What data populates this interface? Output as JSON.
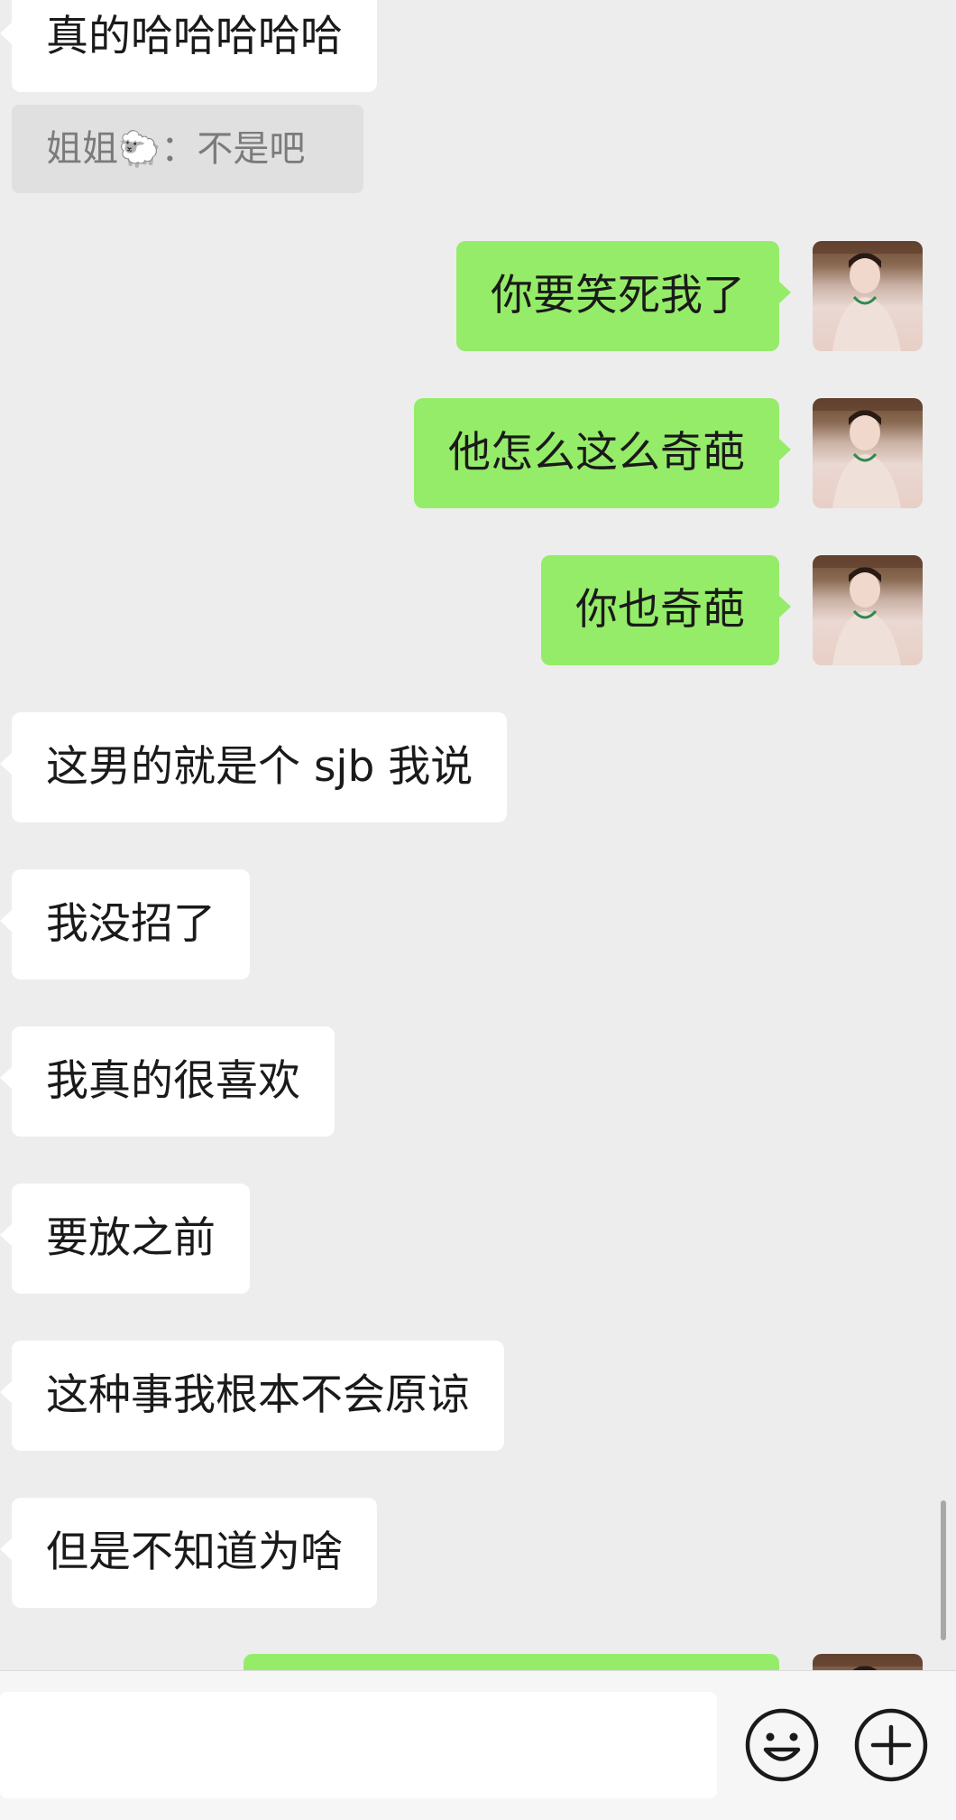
{
  "messages": [
    {
      "dir": "in",
      "text": "真的哈哈哈哈哈"
    },
    {
      "dir": "out",
      "text": "你要笑死我了"
    },
    {
      "dir": "out",
      "text": "他怎么这么奇葩"
    },
    {
      "dir": "out",
      "text": "你也奇葩"
    },
    {
      "dir": "in",
      "text": "这男的就是个 sjb 我说"
    },
    {
      "dir": "in",
      "text": "我没招了"
    },
    {
      "dir": "in",
      "text": "我真的很喜欢"
    },
    {
      "dir": "in",
      "text": "要放之前"
    },
    {
      "dir": "in",
      "text": "这种事我根本不会原谅"
    },
    {
      "dir": "in",
      "text": "但是不知道为啥"
    }
  ],
  "quote": {
    "sender": "姐姐",
    "emoji": "🐑",
    "separator": "：",
    "text": "不是吧"
  },
  "input": {
    "value": ""
  },
  "icons": {
    "emoji_button": "smiley-icon",
    "more_button": "plus-circle-icon"
  },
  "colors": {
    "background": "#ededed",
    "outgoing": "#95ec69",
    "incoming": "#ffffff",
    "quote_bg": "#e0e0e0"
  }
}
